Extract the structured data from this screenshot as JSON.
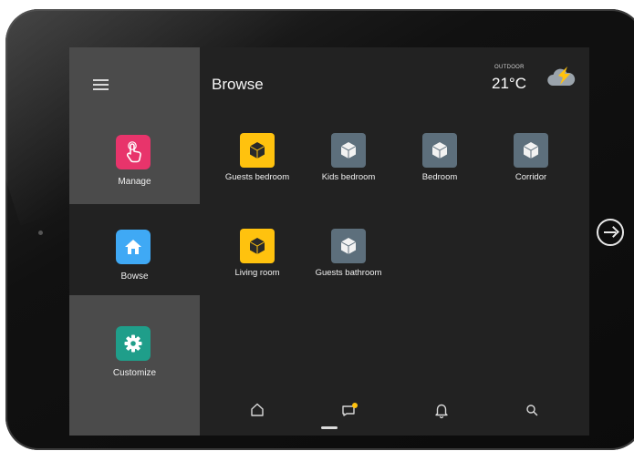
{
  "header": {
    "title": "Browse",
    "weather": {
      "caption": "OUTDOOR",
      "temperature": "21°C",
      "icon": "cloud-lightning-icon"
    }
  },
  "sidebar": {
    "menu_icon": "hamburger-menu-icon",
    "items": [
      {
        "label": "Manage",
        "icon": "hand-pointer-icon",
        "color": "#e8346b",
        "selected": false
      },
      {
        "label": "Bowse",
        "icon": "home-icon",
        "color": "#3fa9f5",
        "selected": true
      },
      {
        "label": "Customize",
        "icon": "gear-icon",
        "color": "#1f9e8a",
        "selected": false
      }
    ]
  },
  "rooms": [
    {
      "label": "Guests bedroom",
      "icon": "cube-icon",
      "active": true
    },
    {
      "label": "Kids bedroom",
      "icon": "cube-icon",
      "active": false
    },
    {
      "label": "Bedroom",
      "icon": "cube-icon",
      "active": false
    },
    {
      "label": "Corridor",
      "icon": "cube-icon",
      "active": false
    },
    {
      "label": "Living room",
      "icon": "cube-icon",
      "active": true
    },
    {
      "label": "Guests bathroom",
      "icon": "cube-icon",
      "active": false
    }
  ],
  "bottom_tabs": [
    {
      "name": "home",
      "icon": "home-outline-icon"
    },
    {
      "name": "messages",
      "icon": "message-badge-icon",
      "badge_color": "#ffc20e"
    },
    {
      "name": "notifications",
      "icon": "bell-icon"
    },
    {
      "name": "search",
      "icon": "search-icon"
    }
  ],
  "colors": {
    "room_active": "#ffc20e",
    "room_inactive": "#5d6f7c",
    "sidebar_panel": "#4b4b4b",
    "screen_bg": "#222222"
  }
}
